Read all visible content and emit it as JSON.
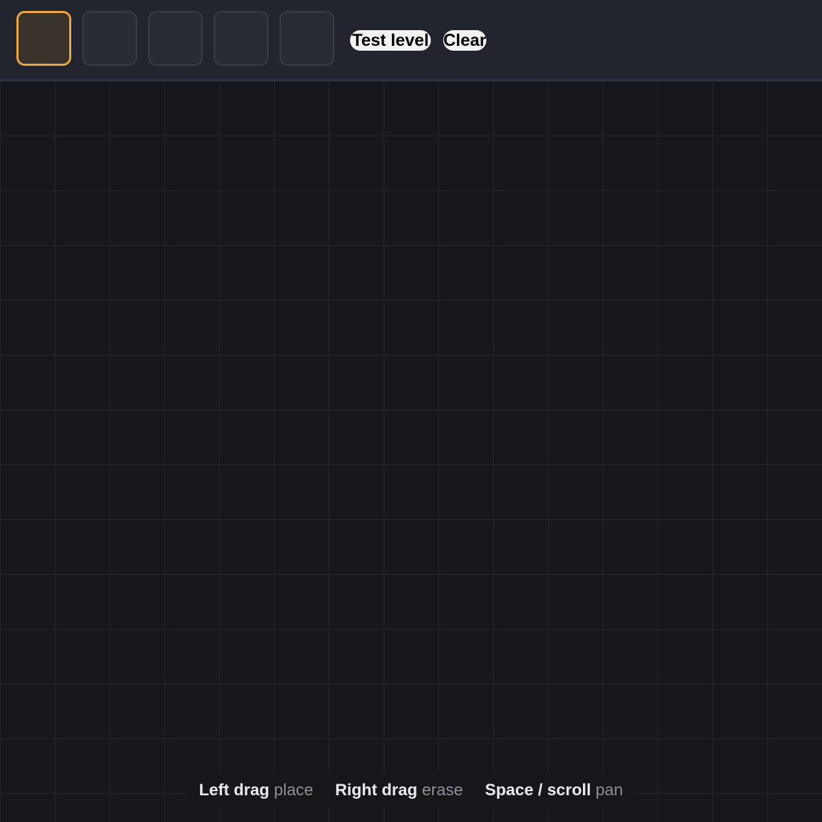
{
  "toolbar": {
    "palette": [
      {
        "name": "tile-1",
        "selected": true
      },
      {
        "name": "tile-2",
        "selected": false
      },
      {
        "name": "tile-3",
        "selected": false
      },
      {
        "name": "tile-4",
        "selected": false
      },
      {
        "name": "tile-5",
        "selected": false
      }
    ],
    "test_level_label": "Test level",
    "clear_label": "Clear"
  },
  "hints": [
    {
      "key": "Left drag",
      "action": "place"
    },
    {
      "key": "Right drag",
      "action": "erase"
    },
    {
      "key": "Space / scroll",
      "action": "pan"
    }
  ],
  "colors": {
    "accent": "#f0a93a",
    "toolbar_bg": "#22252e",
    "canvas_bg": "#16171b",
    "grid_line": "#272930",
    "button_bg": "#f2f2f2"
  }
}
